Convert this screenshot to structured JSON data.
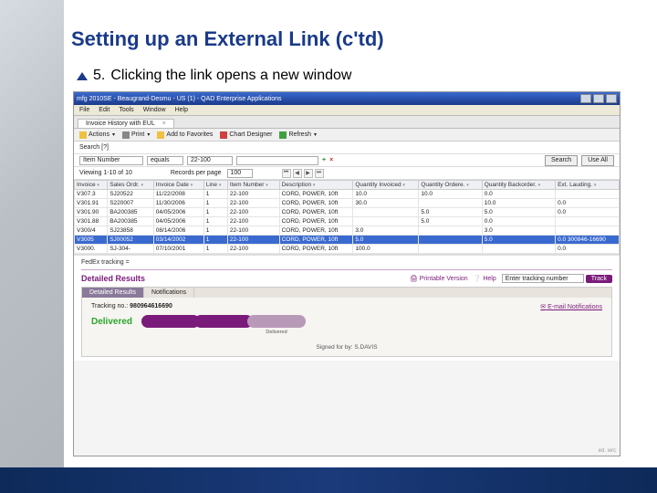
{
  "slide": {
    "title": "Setting up an External Link (c'td)",
    "bullet_num": "5.",
    "bullet_text": "Clicking the link opens a new window"
  },
  "window": {
    "title": "mfg 2010SE - Beaugrand-Desmu - US (1) - QAD Enterprise Applications"
  },
  "menu": [
    "File",
    "Edit",
    "Tools",
    "Window",
    "Help"
  ],
  "tab": {
    "label": "Invoice History with EUL",
    "close": "×"
  },
  "toolbar": {
    "actions": "Actions",
    "print": "Print",
    "fav": "Add to Favorites",
    "chart": "Chart Designer",
    "refresh": "Refresh"
  },
  "search": {
    "label": "Search [?]",
    "field1_label": "Item Number",
    "field1_op": "equals",
    "field1_val": "22-100",
    "plus": "+",
    "x": "×",
    "search_btn": "Search",
    "useall_btn": "Use All"
  },
  "view": {
    "status": "Viewing 1-10 of 10",
    "perpage_label": "Records per page",
    "perpage_val": "100"
  },
  "grid": {
    "cols": [
      "Invoice",
      "Sales Ordr.",
      "Invoice Date",
      "Line",
      "Item Number",
      "Description",
      "Quantity Invoiced",
      "Quantity Ordere.",
      "Quantity Backorder.",
      "Ext. Lauding."
    ],
    "rows": [
      [
        "V307.3",
        "SJ20522",
        "11/22/2008",
        "1",
        "22-100",
        "CORD, POWER, 10ft",
        "10.0",
        "10.0",
        "0.0",
        ""
      ],
      [
        "V301.91",
        "S220007",
        "11/30/2006",
        "1",
        "22-100",
        "CORD, POWER, 10ft",
        "30.0",
        "",
        "10.0",
        "0.0"
      ],
      [
        "V301.90",
        "BA200385",
        "04/05/2006",
        "1",
        "22-100",
        "CORD, POWER, 10ft",
        "",
        "5.0",
        "5.0",
        "0.0"
      ],
      [
        "V301.88",
        "BA200385",
        "04/05/2006",
        "1",
        "22-100",
        "CORD, POWER, 10ft",
        "",
        "5.0",
        "0.0",
        ""
      ],
      [
        "V300/4",
        "SJ23858",
        "08/14/2006",
        "1",
        "22-100",
        "CORD, POWER, 10ft",
        "3.0",
        "",
        "3.0",
        ""
      ],
      [
        "V3005",
        "SJ00052",
        "03/14/2002",
        "1",
        "22-100",
        "CORD, POWER, 10ft",
        "5.0",
        "",
        "5.0",
        "0.0  300846-16690"
      ],
      [
        "V3000.",
        "SJ-304-",
        "07/10/2001",
        "1",
        "22-100",
        "CORD, POWER, 10ft",
        "100.0",
        "",
        "",
        "0.0"
      ]
    ],
    "selected_index": 5
  },
  "fedex": {
    "label": "FedEx tracking ="
  },
  "track": {
    "detailed": "Detailed Results",
    "printable": "Printable Version",
    "help": "Help",
    "input_ph": "Enter tracking number",
    "btn": "Track",
    "tabs": [
      "Detailed Results",
      "Notifications"
    ],
    "tracking_label": "Tracking no.:",
    "tracking_no": "980964616690",
    "email": "E-mail Notifications",
    "delivered": "Delivered",
    "stages": [
      "",
      "",
      "Delivered"
    ],
    "signed": "Signed for by: S.DAVIS",
    "corner": "ed. wrc"
  }
}
